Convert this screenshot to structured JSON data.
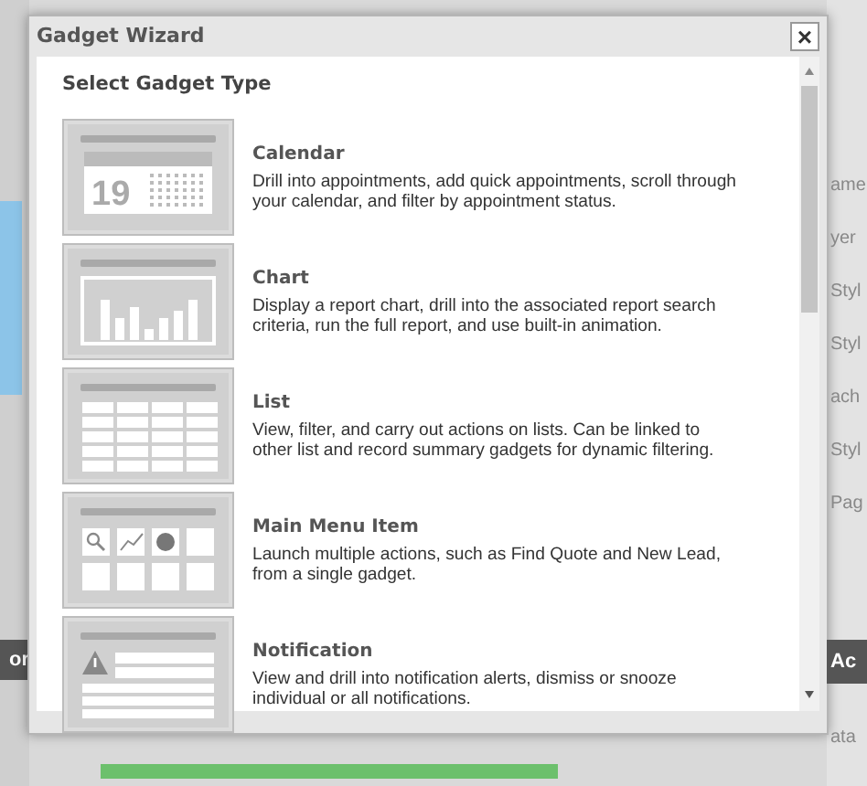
{
  "dialog": {
    "title": "Gadget Wizard",
    "close": "×",
    "heading": "Select Gadget Type"
  },
  "gadget_types": [
    {
      "kind": "calendar",
      "name": "Calendar",
      "description": "Drill into appointments, add quick appointments, scroll through your calendar, and filter by appointment status.",
      "day": "19"
    },
    {
      "kind": "chart",
      "name": "Chart",
      "description": "Display a report chart, drill into the associated report search criteria, run the full report, and use built-in animation."
    },
    {
      "kind": "list",
      "name": "List",
      "description": "View, filter, and carry out actions on lists. Can be linked to other list and record summary gadgets for dynamic filtering."
    },
    {
      "kind": "menu",
      "name": "Main Menu Item",
      "description": "Launch multiple actions, such as Find Quote and New Lead, from a single gadget."
    },
    {
      "kind": "notification",
      "name": "Notification",
      "description": "View and drill into notification alerts, dismiss or snooze individual or all notifications."
    }
  ],
  "background": {
    "right_labels": [
      "ame",
      "yer",
      "Styl",
      "Styl",
      "ach",
      "Styl",
      "Pag"
    ],
    "right_header": "Ac",
    "right_footer": "ata",
    "left_header": "or"
  }
}
